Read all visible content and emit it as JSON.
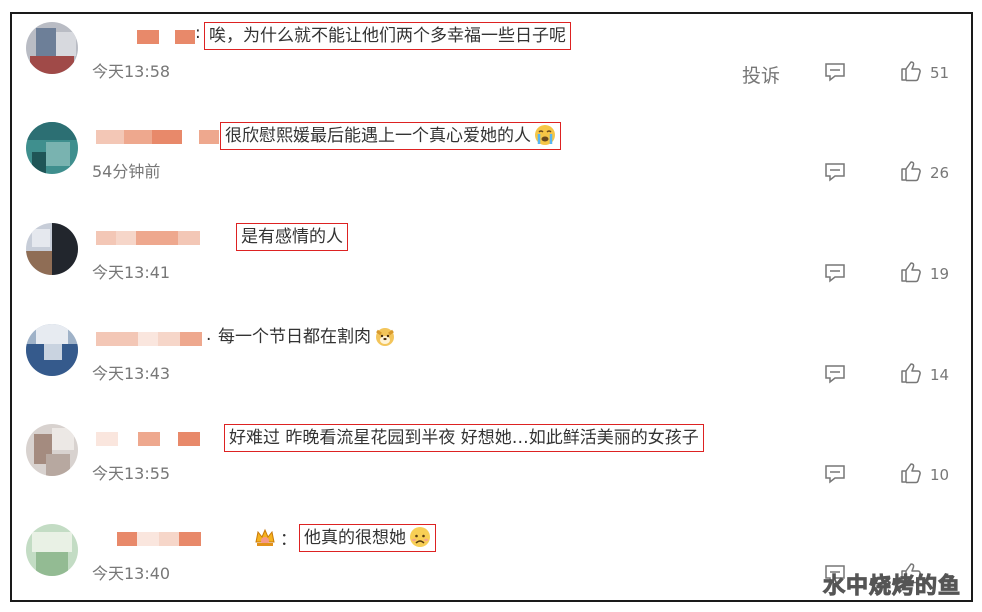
{
  "report_label": "投诉",
  "watermark": "水中烧烤的鱼",
  "comments": [
    {
      "text": "唉，为什么就不能让他们两个多幸福一些日子呢",
      "time": "今天13:58",
      "likes": "51",
      "prefix": ":"
    },
    {
      "text": "很欣慰熙媛最后能遇上一个真心爱她的人",
      "time": "54分钟前",
      "likes": "26",
      "emoji": "crying-face"
    },
    {
      "text": "是有感情的人",
      "time": "今天13:41",
      "likes": "19"
    },
    {
      "text": "每一个节日都在割肉",
      "time": "今天13:43",
      "likes": "14",
      "prefix": ".",
      "emoji": "dog-face"
    },
    {
      "text": "好难过 昨晚看流星花园到半夜 好想她…如此鲜活美丽的女孩子",
      "time": "今天13:55",
      "likes": "10"
    },
    {
      "text": "他真的很想她",
      "time": "今天13:40",
      "likes": "",
      "prefix": "：",
      "emoji": "sad-face",
      "badge": "crown"
    }
  ],
  "colors": {
    "highlight_border": "#dd2222",
    "mosaic": "#e8896a",
    "meta_text": "#777777"
  }
}
